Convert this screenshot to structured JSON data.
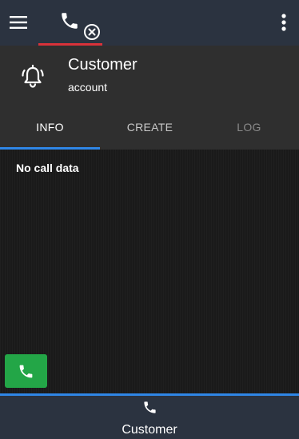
{
  "topbar": {
    "menu_icon": "hamburger-menu-icon",
    "phone_icon": "phone-icon",
    "status_icon": "close-circle-icon",
    "overflow_icon": "kebab-menu-icon",
    "active_underline_color": "#d9323a"
  },
  "header": {
    "icon": "bell-ringing-icon",
    "title": "Customer",
    "subtitle": "account"
  },
  "tabs": [
    {
      "label": "INFO",
      "active": true
    },
    {
      "label": "CREATE",
      "active": false
    },
    {
      "label": "LOG",
      "active": false
    }
  ],
  "content": {
    "message": "No call data"
  },
  "call_button": {
    "icon": "phone-icon",
    "color": "#23a647"
  },
  "bottom_nav": {
    "icon": "phone-icon",
    "label": "Customer",
    "accent": "#2f86e6"
  }
}
